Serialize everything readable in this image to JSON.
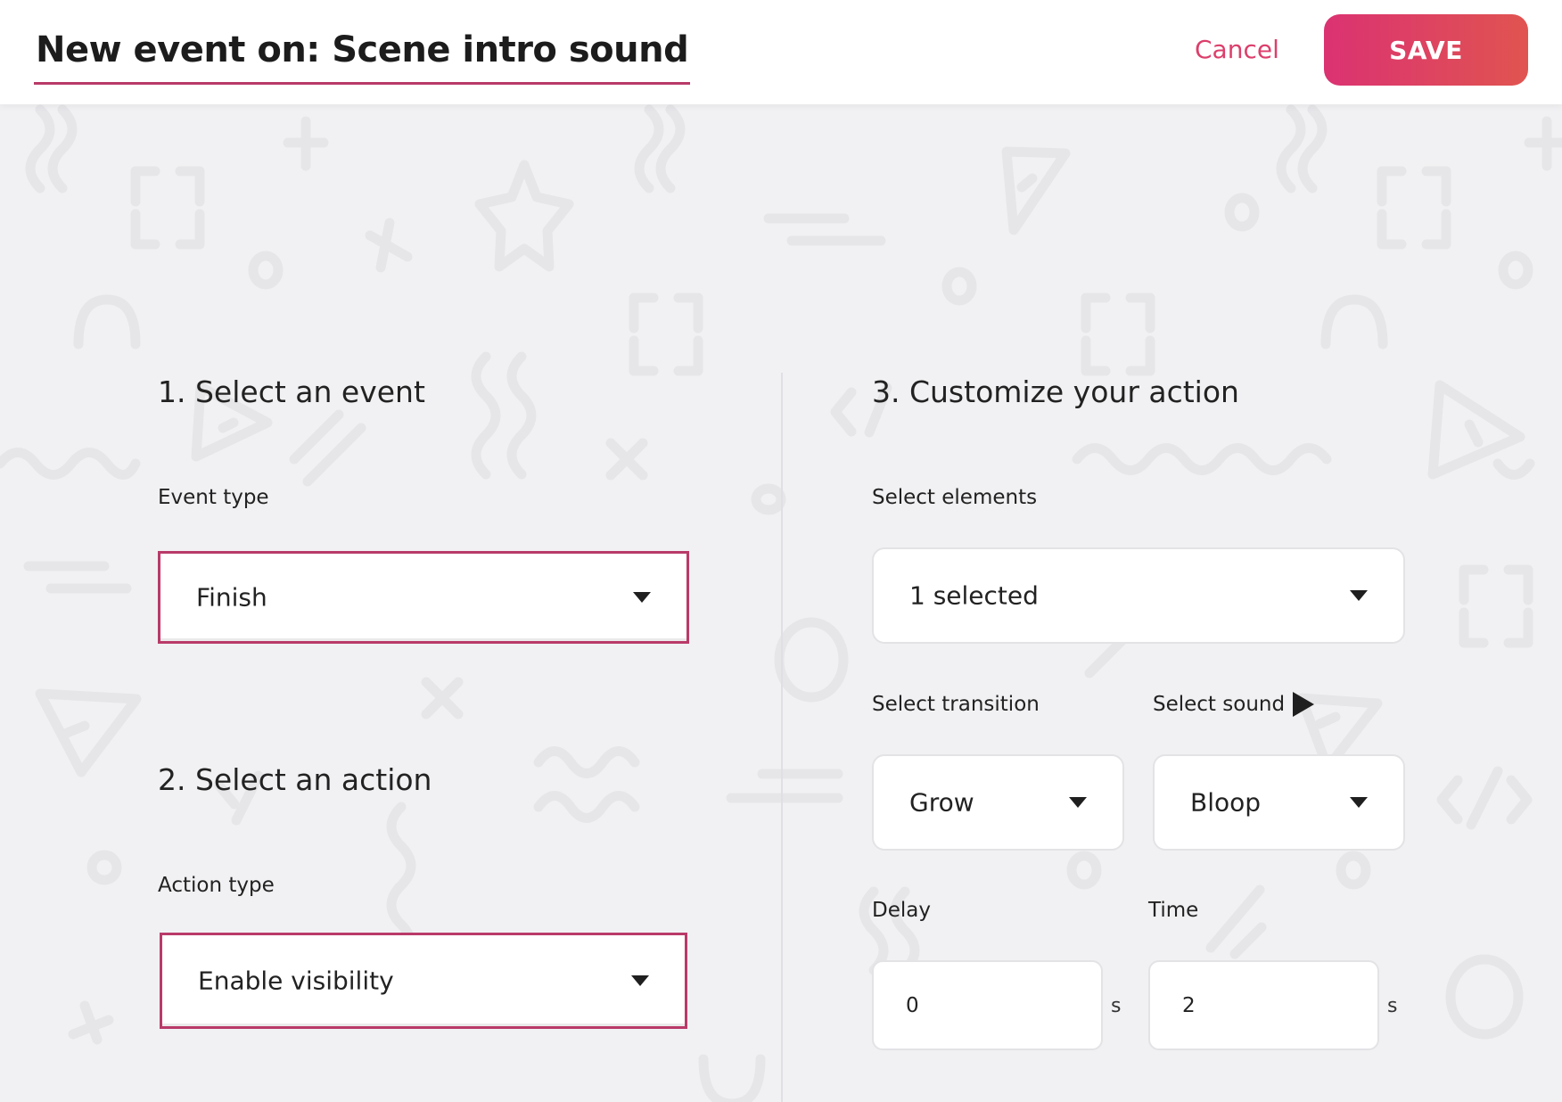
{
  "header": {
    "title": "New event on: Scene intro sound",
    "cancel_label": "Cancel",
    "save_label": "SAVE"
  },
  "colors": {
    "accent": "#b93a68",
    "cancel_text": "#dc3f6b",
    "save_gradient_start": "#db3272",
    "save_gradient_end": "#e05450",
    "background": "#f1f1f3"
  },
  "step1": {
    "heading": "1. Select an event",
    "event_type_label": "Event type",
    "event_type_value": "Finish"
  },
  "step2": {
    "heading": "2. Select an action",
    "action_type_label": "Action type",
    "action_type_value": "Enable visibility"
  },
  "step3": {
    "heading": "3. Customize your action",
    "select_elements_label": "Select elements",
    "select_elements_value": "1 selected",
    "transition_label": "Select transition",
    "transition_value": "Grow",
    "sound_label": "Select sound",
    "sound_value": "Bloop",
    "delay_label": "Delay",
    "delay_value": "0",
    "delay_unit": "s",
    "time_label": "Time",
    "time_value": "2",
    "time_unit": "s"
  },
  "icons": {
    "dropdown": "caret-down-icon",
    "play": "play-icon"
  }
}
